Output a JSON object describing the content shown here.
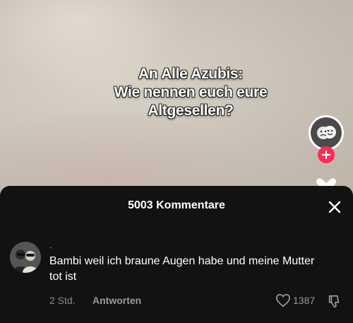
{
  "video": {
    "caption_lines": [
      "An Alle Azubis:",
      "Wie nennen euch eure",
      "Altgesellen?"
    ]
  },
  "comments_sheet": {
    "title": "5003 Kommentare",
    "comments": [
      {
        "username": ".",
        "text": "Bambi weil ich braune Augen habe und meine Mutter tot ist",
        "time": "2 Std.",
        "reply_label": "Antworten",
        "likes": "1387"
      }
    ]
  },
  "icons": {
    "close": "close-icon",
    "follow": "plus-icon",
    "like": "heart-outline-icon",
    "dislike": "thumbs-down-icon"
  },
  "colors": {
    "accent": "#fe2c55",
    "sheet_bg": "#121212"
  }
}
